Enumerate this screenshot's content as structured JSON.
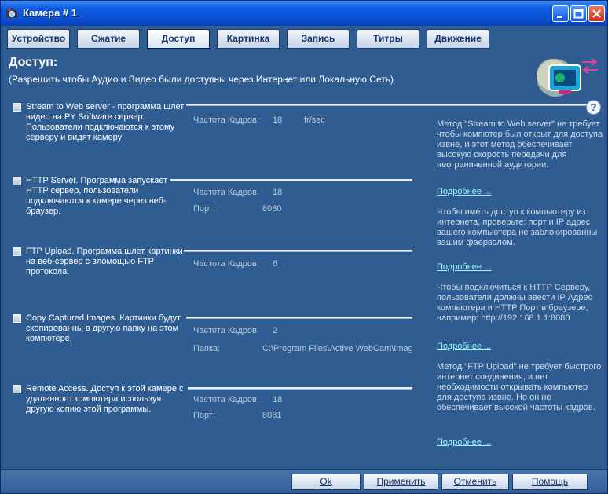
{
  "window": {
    "title": "Камера # 1"
  },
  "tabs": [
    {
      "label": "Устройство"
    },
    {
      "label": "Сжатие"
    },
    {
      "label": "Доступ",
      "active": true
    },
    {
      "label": "Картинка"
    },
    {
      "label": "Запись"
    },
    {
      "label": "Титры"
    },
    {
      "label": "Движение"
    }
  ],
  "header": {
    "title": "Доступ:",
    "subtitle": "(Разрешить чтобы Аудио и Видео были доступны через Интернет или Локальную Сеть)"
  },
  "sections": [
    {
      "checked": false,
      "text": "Stream to Web server - программа шлет видео на PY Software сервер. Пользователи подключаются к этому серверу и видят камеру",
      "fields": [
        {
          "label": "Частота Кадров:",
          "value": "18",
          "unit": "fr/sec"
        }
      ]
    },
    {
      "checked": false,
      "text": "HTTP Server. Программа запускает HTTP сервер, пользователи подключаются к камере через веб-браузер.",
      "fields": [
        {
          "label": "Частота Кадров:",
          "value": "18"
        },
        {
          "label": "Порт:",
          "value": "8080"
        }
      ]
    },
    {
      "checked": false,
      "text": "FTP Upload. Программа шлет картинки на веб-сервер с вломощью FTP протокола.",
      "fields": [
        {
          "label": "Частота Кадров:",
          "value": "6"
        }
      ]
    },
    {
      "checked": false,
      "text": "Copy Captured Images. Картинки будут скопированны в другую папку на этом компютере.",
      "fields": [
        {
          "label": "Частота Кадров:",
          "value": "2"
        },
        {
          "label": "Папка:",
          "value": "C:\\Program Files\\Active WebCam\\Imag"
        }
      ]
    },
    {
      "checked": false,
      "text": "Remote Access. Доступ к этой камере с удаленного компютера используя другую копию этой программы.",
      "fields": [
        {
          "label": "Частота Кадров:",
          "value": "18"
        },
        {
          "label": "Порт:",
          "value": "8081"
        }
      ]
    }
  ],
  "info": [
    {
      "text": "Метод \"Stream to Web server\" не требует чтобы компютер был открыт для доступа извне, и этот метод обеспечивает высокую скорость передачи для неограниченной аудитории.",
      "link": "Подробнее ..."
    },
    {
      "text": "Чтобы иметь доступ к компьютеру из интернета, проверьте: порт и IP адрес вашего компьютера не заблокированны вашим фаерволом.",
      "link": "Подробнее ..."
    },
    {
      "text": "Чтобы подключиться к HTTP Серверу, пользователи должны ввести IP Адрес компьютера и HTTP Порт в браузере, например: http://192.168.1.1:8080",
      "link": "Подробнее ..."
    },
    {
      "text": "Метод \"FTP Upload\" не требует быстрого интернет соединения, и нет необходимости открывать компьютер для доступа извне. Но он не обеспечивает высокой частоты кадров.",
      "link": "Подробнее ..."
    }
  ],
  "help": {
    "label": "?"
  },
  "buttons": {
    "ok": "Ok",
    "apply": "Применить",
    "cancel": "Отменить",
    "help": "Помощь"
  }
}
